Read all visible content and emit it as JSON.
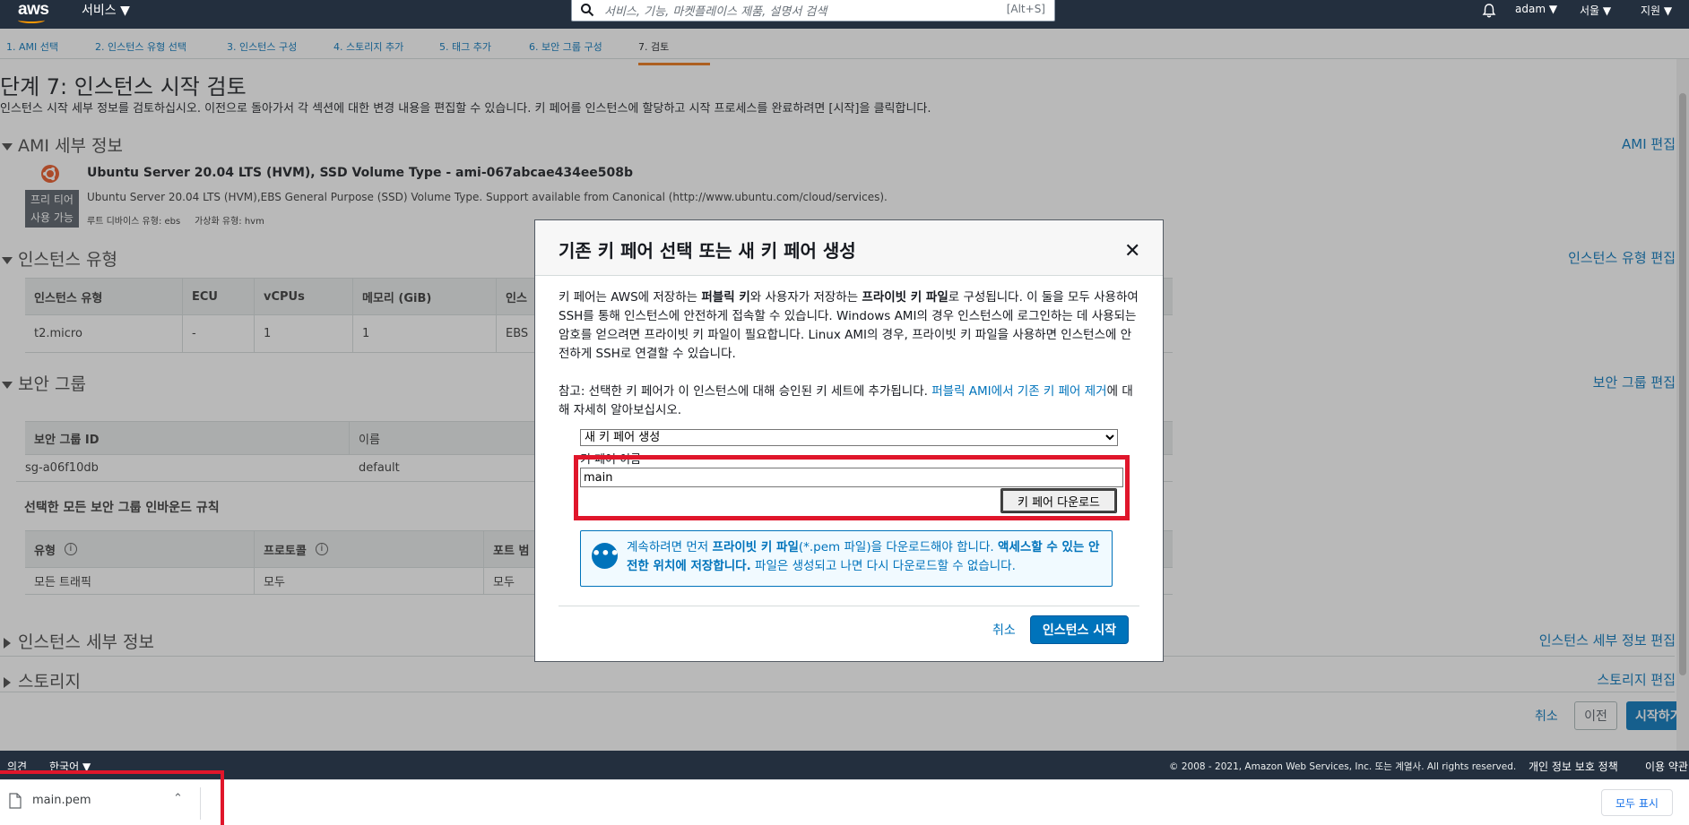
{
  "topnav": {
    "logo": "aws",
    "services": "서비스 ▼",
    "search_placeholder": "서비스, 기능, 마켓플레이스 제품, 설명서 검색",
    "search_hotkey": "[Alt+S]",
    "user": "adam ▼",
    "region": "서울 ▼",
    "support": "지원 ▼"
  },
  "steps": [
    "1. AMI 선택",
    "2. 인스턴스 유형 선택",
    "3. 인스턴스 구성",
    "4. 스토리지 추가",
    "5. 태그 추가",
    "6. 보안 그룹 구성",
    "7. 검토"
  ],
  "page": {
    "title": "단계 7: 인스턴스 시작 검토",
    "description": "인스턴스 시작 세부 정보를 검토하십시오. 이전으로 돌아가서 각 섹션에 대한 변경 내용을 편집할 수 있습니다. 키 페어를 인스턴스에 할당하고 시작 프로세스를 완료하려면 [시작]을 클릭합니다."
  },
  "ami": {
    "section": "AMI 세부 정보",
    "edit": "AMI 편집",
    "name": "Ubuntu Server 20.04 LTS (HVM), SSD Volume Type - ami-067abcae434ee508b",
    "badge_line1": "프리 티어",
    "badge_line2": "사용 가능",
    "desc": "Ubuntu Server 20.04 LTS (HVM),EBS General Purpose (SSD) Volume Type. Support available from Canonical (http://www.ubuntu.com/cloud/services).",
    "meta": "루트 디바이스 유형: ebs     가상화 유형: hvm"
  },
  "instance_type": {
    "section": "인스턴스 유형",
    "edit": "인스턴스 유형 편집",
    "headers": [
      "인스턴스 유형",
      "ECU",
      "vCPUs",
      "메모리 (GiB)",
      "인스"
    ],
    "row": [
      "t2.micro",
      "-",
      "1",
      "1",
      "EBS"
    ]
  },
  "security": {
    "section": "보안 그룹",
    "edit": "보안 그룹 편집",
    "headers": [
      "보안 그룹 ID",
      "이름"
    ],
    "row": [
      "sg-a06f10db",
      "default"
    ],
    "rules_title": "선택한 모든 보안 그룹 인바운드 규칙",
    "rule_headers": [
      "유형",
      "프로토콜",
      "포트 범"
    ],
    "rule_row": [
      "모든 트래픽",
      "모두",
      "모두"
    ]
  },
  "details": {
    "section": "인스턴스 세부 정보",
    "edit": "인스턴스 세부 정보 편집"
  },
  "storage": {
    "section": "스토리지",
    "edit": "스토리지 편집"
  },
  "actions": {
    "cancel": "취소",
    "prev": "이전",
    "launch": "시작하기"
  },
  "modal": {
    "title": "기존 키 페어 선택 또는 새 키 페어 생성",
    "para1_a": "키 페어는 AWS에 저장하는 ",
    "para1_b": "퍼블릭 키",
    "para1_c": "와 사용자가 저장하는 ",
    "para1_d": "프라이빗 키 파일",
    "para1_e": "로 구성됩니다. 이 둘을 모두 사용하여 SSH를 통해 인스턴스에 안전하게 접속할 수 있습니다. Windows AMI의 경우 인스턴스에 로그인하는 데 사용되는 암호를 얻으려면 프라이빗 키 파일이 필요합니다. Linux AMI의 경우, 프라이빗 키 파일을 사용하면 인스턴스에 안전하게 SSH로 연결할 수 있습니다.",
    "para2_a": "참고: 선택한 키 페어가 이 인스턴스에 대해 승인된 키 세트에 추가됩니다. ",
    "para2_link": "퍼블릭 AMI에서 기존 키 페어 제거",
    "para2_b": "에 대해 자세히 알아보십시오.",
    "select_value": "새 키 페어 생성",
    "keypair_label": "키 페어 이름",
    "keypair_value": "main",
    "download": "키 페어 다운로드",
    "info_a": "계속하려면 먼저 ",
    "info_b": "프라이빗 키 파일",
    "info_c": "(*.pem 파일)을 다운로드해야 합니다. ",
    "info_d": "액세스할 수 있는 안전한 위치에 저장합니다.",
    "info_e": " 파일은 생성되고 나면 다시 다운로드할 수 없습니다.",
    "cancel": "취소",
    "launch": "인스턴스 시작"
  },
  "footer": {
    "feedback": "의견",
    "lang": "한국어",
    "copyright": "© 2008 - 2021, Amazon Web Services, Inc. 또는 계열사. All rights reserved.",
    "privacy": "개인 정보 보호 정책",
    "terms": "이용 약관"
  },
  "downloads": {
    "file": "main.pem",
    "show_all": "모두 표시"
  }
}
